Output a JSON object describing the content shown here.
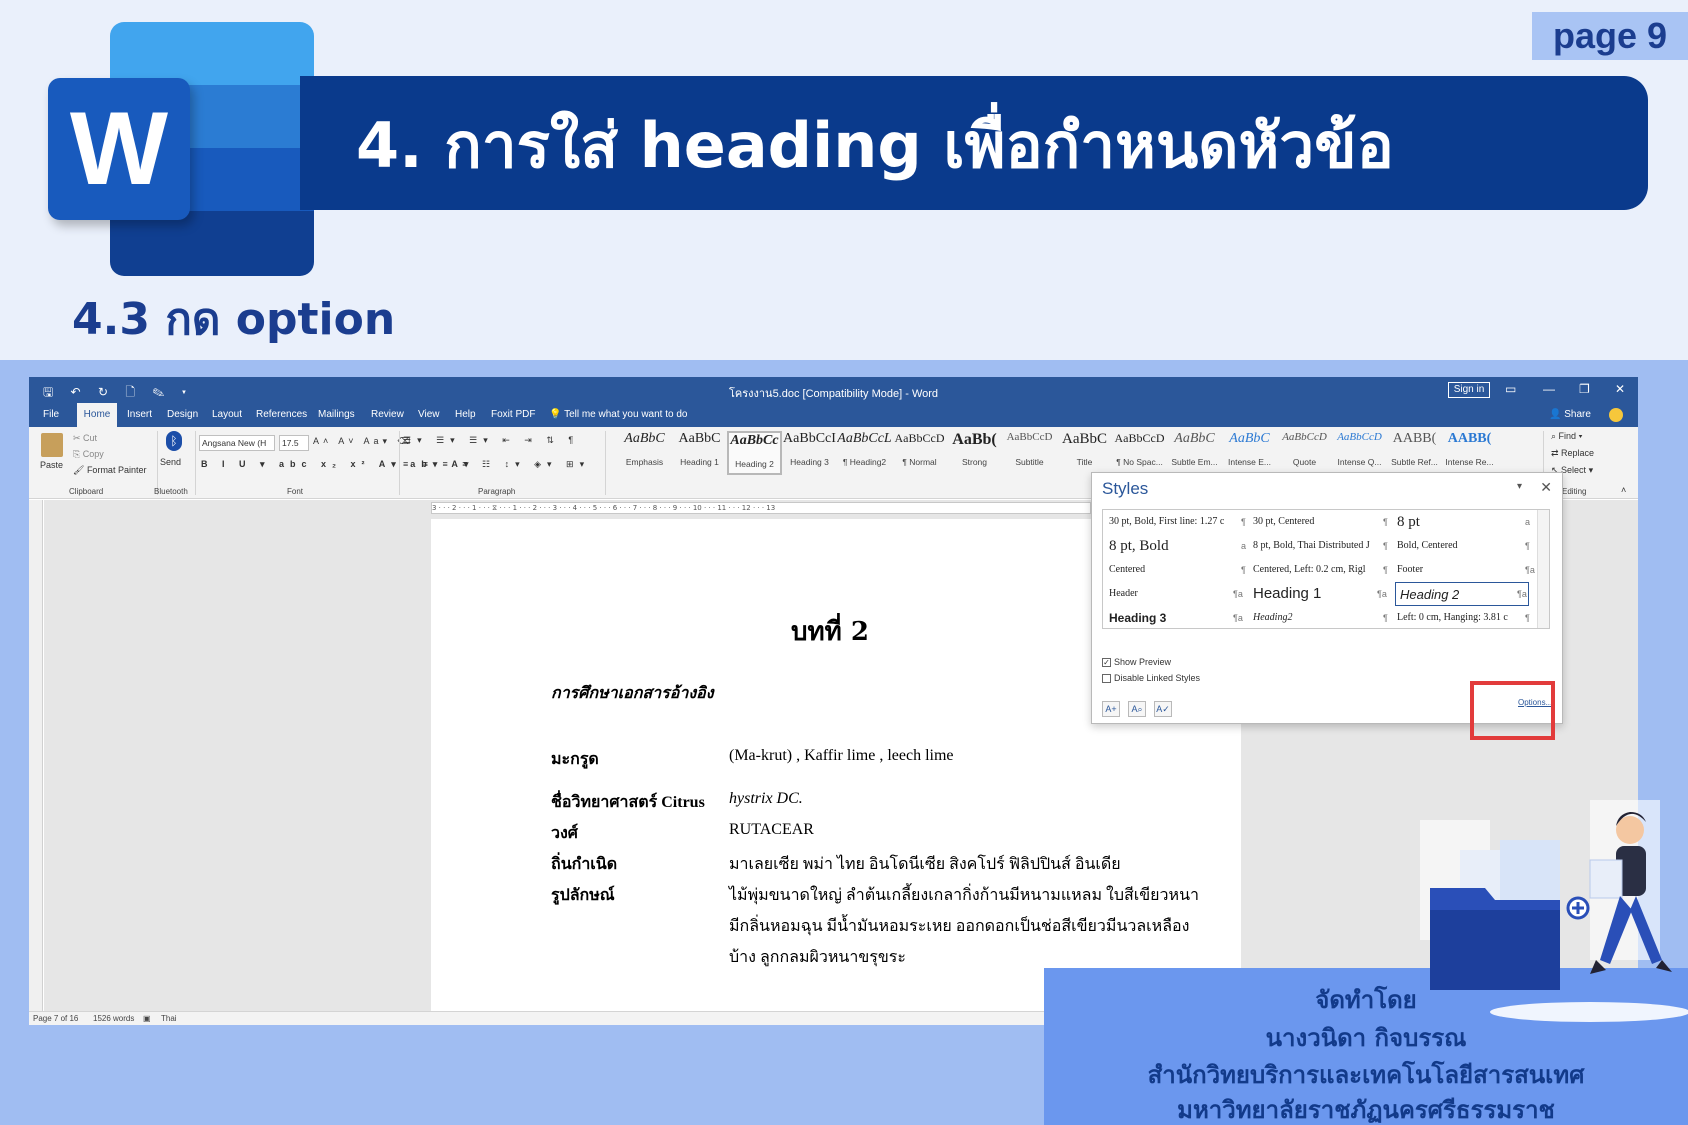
{
  "slide": {
    "page_label": "page 9",
    "title": "4. การใส่ heading เพื่อกำหนดหัวข้อ",
    "subtitle": "4.3 กด option",
    "logo_letter": "W"
  },
  "word": {
    "doc_title": "โครงงาน5.doc [Compatibility Mode]  -  Word",
    "sign_in": "Sign in",
    "tabs": [
      "File",
      "Home",
      "Insert",
      "Design",
      "Layout",
      "References",
      "Mailings",
      "Review",
      "View",
      "Help",
      "Foxit PDF"
    ],
    "tell_me": "Tell me what you want to do",
    "share": "Share",
    "ribbon": {
      "cut": "Cut",
      "copy": "Copy",
      "format_painter": "Format Painter",
      "paste": "Paste",
      "send": "Send",
      "font_name": "Angsana New (H",
      "font_size": "17.5",
      "find": "Find",
      "replace": "Replace",
      "select": "Select",
      "groups": {
        "clipboard": "Clipboard",
        "bluetooth": "Bluetooth",
        "font": "Font",
        "paragraph": "Paragraph",
        "editing": "Editing"
      }
    },
    "gallery": [
      {
        "preview": "AaBbC",
        "name": "Emphasis"
      },
      {
        "preview": "AaBbC",
        "name": "Heading 1"
      },
      {
        "preview": "AaBbCc",
        "name": "Heading 2"
      },
      {
        "preview": "AaBbCcI",
        "name": "Heading 3"
      },
      {
        "preview": "AaBbCcL",
        "name": "¶ Heading2"
      },
      {
        "preview": "AaBbCcD",
        "name": "¶ Normal"
      },
      {
        "preview": "AaBb(",
        "name": "Strong"
      },
      {
        "preview": "AaBbCcD",
        "name": "Subtitle"
      },
      {
        "preview": "AaBbC",
        "name": "Title"
      },
      {
        "preview": "AaBbCcD",
        "name": "¶ No Spac..."
      },
      {
        "preview": "AaBbC",
        "name": "Subtle Em..."
      },
      {
        "preview": "AaBbC",
        "name": "Intense E..."
      },
      {
        "preview": "AaBbCcD",
        "name": "Quote"
      },
      {
        "preview": "AaBbCcD",
        "name": "Intense Q..."
      },
      {
        "preview": "AABB(",
        "name": "Subtle Ref..."
      },
      {
        "preview": "AABB(",
        "name": "Intense Re..."
      }
    ],
    "document": {
      "chapter": "บทที่  2",
      "section": "การศึกษาเอกสารอ้างอิง",
      "rows": [
        {
          "label": "มะกรูด",
          "value": "(Ma-krut) , Kaffir lime , leech  lime"
        },
        {
          "label": "ชื่อวิทยาศาสตร์ Citrus",
          "value": "hystrix  DC."
        },
        {
          "label": "วงศ์",
          "value": "RUTACEAR"
        },
        {
          "label": "ถิ่นกำเนิด",
          "value": "มาเลยเซีย  พม่า  ไทย  อินโดนีเซีย  สิงคโปร์  ฟิลิปปินส์  อินเดีย"
        },
        {
          "label": "รูปลักษณ์",
          "value": "ไม้พุ่มขนาดใหญ่  ลำต้นเกลี้ยงเกลากิ่งก้านมีหนามแหลม  ใบสีเขียวหนา"
        },
        {
          "label": "",
          "value": "มีกลิ่นหอมฉุน  มีน้ำมันหอมระเหย  ออกดอกเป็นช่อสีเขียวมีนวลเหลือง"
        },
        {
          "label": "",
          "value": "บ้าง  ลูกกลมผิวหนาขรุขระ"
        }
      ]
    },
    "styles_pane": {
      "title": "Styles",
      "items": [
        "30 pt, Bold, First line:  1.27 c",
        "30 pt, Centered",
        "8 pt",
        "8 pt, Bold",
        "8 pt, Bold, Thai Distributed J",
        "Bold, Centered",
        "Centered",
        "Centered, Left:  0.2 cm, Rigl",
        "Footer",
        "Header",
        "Heading 1",
        "Heading 2",
        "Heading 3",
        "Heading2",
        "Left:  0 cm, Hanging:  3.81 c"
      ],
      "show_preview": "Show Preview",
      "disable_linked": "Disable Linked Styles",
      "options": "Options..."
    },
    "status": {
      "page": "Page 7 of 16",
      "words": "1526 words",
      "language": "Thai"
    }
  },
  "credits": [
    "จัดทำโดย",
    "นางวนิดา กิจบรรณ",
    "สำนักวิทยบริการและเทคโนโลยีสารสนเทศ",
    "มหาวิทยาลัยราชภัฏนครศรีธรรมราช"
  ],
  "colors": {
    "word_blue": "#2b579a",
    "title_bar": "#0a3a8c",
    "highlight": "#e23b3b"
  }
}
